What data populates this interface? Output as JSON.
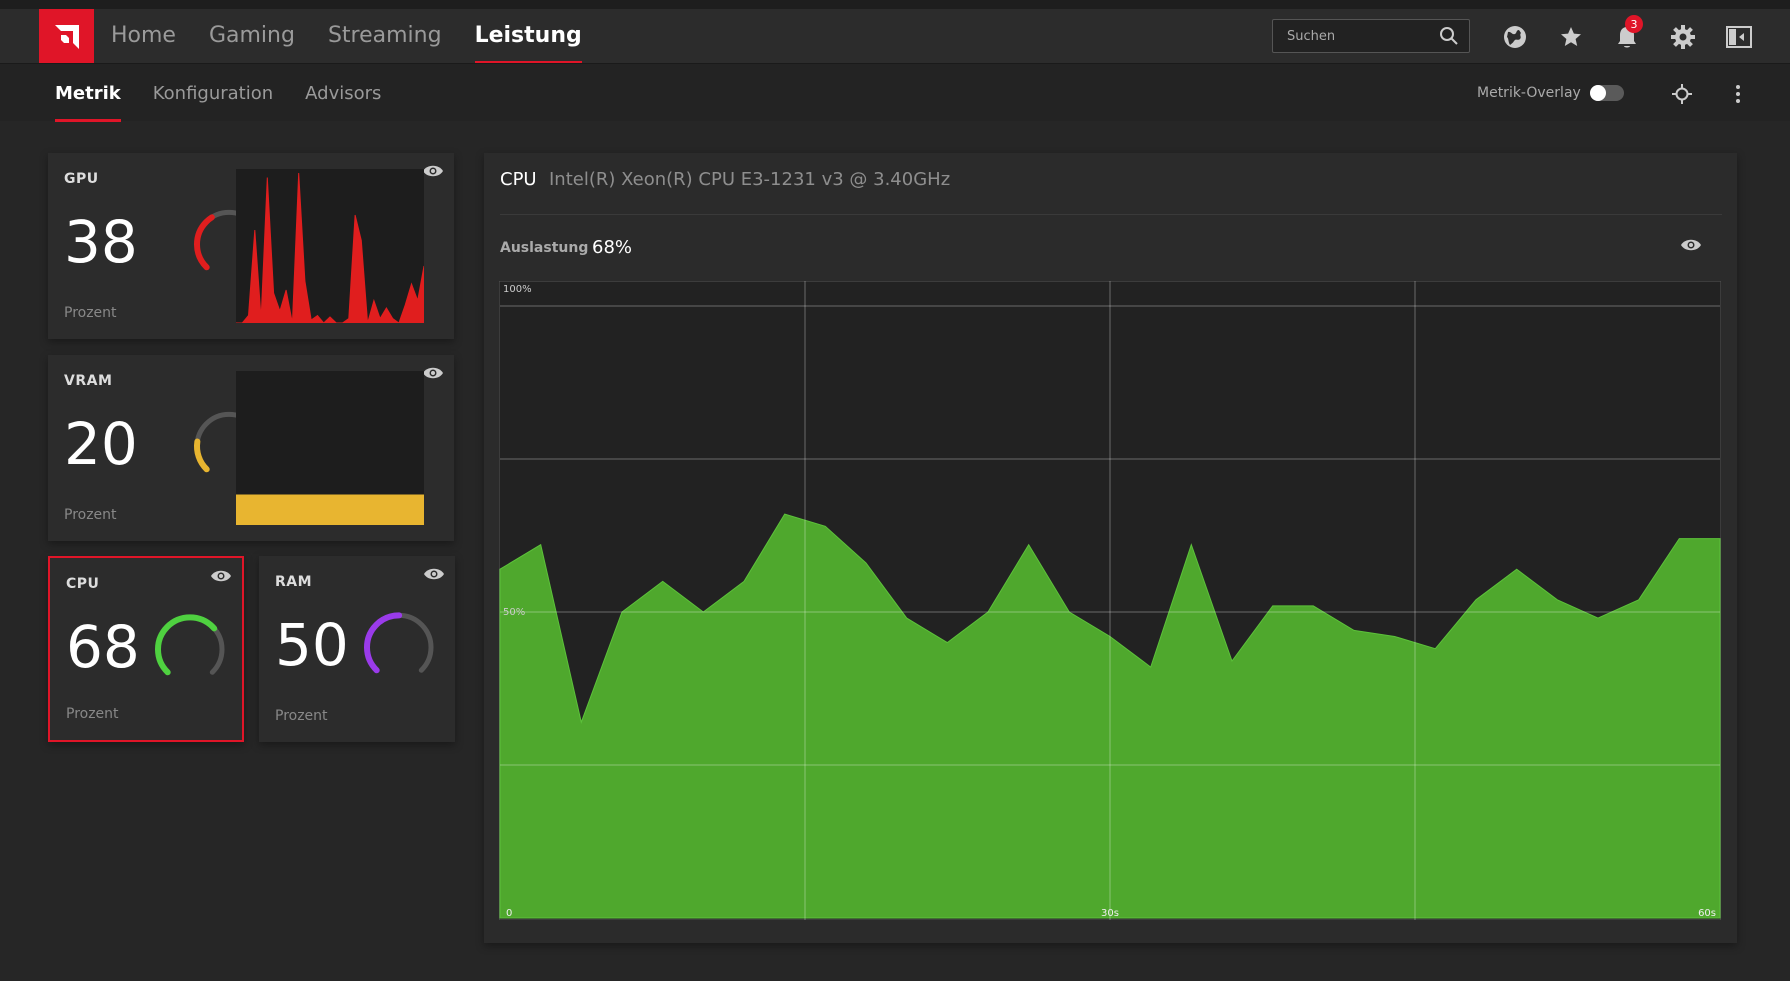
{
  "topbar": {
    "tabs": [
      {
        "label": "Home",
        "active": false
      },
      {
        "label": "Gaming",
        "active": false
      },
      {
        "label": "Streaming",
        "active": false
      },
      {
        "label": "Leistung",
        "active": true
      }
    ],
    "search": {
      "placeholder": "Suchen"
    },
    "notification_count": "3",
    "icons": [
      "globe-icon",
      "star-icon",
      "bell-icon",
      "gear-icon",
      "sidebar-toggle-icon"
    ]
  },
  "subbar": {
    "tabs": [
      {
        "label": "Metrik",
        "active": true
      },
      {
        "label": "Konfiguration",
        "active": false
      },
      {
        "label": "Advisors",
        "active": false
      }
    ],
    "overlay_label": "Metrik-Overlay",
    "overlay_enabled": false
  },
  "metrics": {
    "gpu": {
      "label": "GPU",
      "value": "38",
      "unit": "Prozent",
      "color": "#e01e1e"
    },
    "vram": {
      "label": "VRAM",
      "value": "20",
      "unit": "Prozent",
      "color": "#e8b530"
    },
    "cpu": {
      "label": "CPU",
      "value": "68",
      "unit": "Prozent",
      "color": "#4fd140"
    },
    "ram": {
      "label": "RAM",
      "value": "50",
      "unit": "Prozent",
      "color": "#9a3bea"
    }
  },
  "sparklines": {
    "gpu": [
      0,
      0,
      5,
      62,
      3,
      97,
      20,
      8,
      22,
      0,
      100,
      28,
      2,
      5,
      0,
      4,
      0,
      0,
      3,
      72,
      55,
      0,
      15,
      3,
      10,
      3,
      0,
      12,
      26,
      15,
      38
    ],
    "vram": [
      20,
      20,
      20,
      20,
      20,
      20,
      20,
      20,
      20,
      20
    ]
  },
  "main": {
    "title": "CPU",
    "subtitle": "Intel(R) Xeon(R) CPU E3-1231 v3 @ 3.40GHz",
    "util_label": "Auslastung",
    "util_value": "68%"
  },
  "chart_data": {
    "type": "area",
    "color": "#4fa82d",
    "ylim": [
      0,
      100
    ],
    "xlim": [
      0,
      60
    ],
    "y_tick_labels": [
      "100%",
      "50%"
    ],
    "x_tick_labels": [
      "0",
      "30s",
      "60s"
    ],
    "x": [
      0,
      2,
      4,
      6,
      8,
      10,
      12,
      14,
      16,
      18,
      20,
      22,
      24,
      26,
      28,
      30,
      32,
      34,
      36,
      38,
      40,
      42,
      44,
      46,
      48,
      50,
      52,
      54,
      56,
      58,
      60
    ],
    "values": [
      57,
      61,
      32,
      50,
      55,
      50,
      55,
      66,
      64,
      58,
      49,
      45,
      50,
      61,
      50,
      46,
      41,
      61,
      42,
      51,
      51,
      47,
      46,
      44,
      52,
      57,
      52,
      49,
      52,
      62,
      62
    ]
  }
}
